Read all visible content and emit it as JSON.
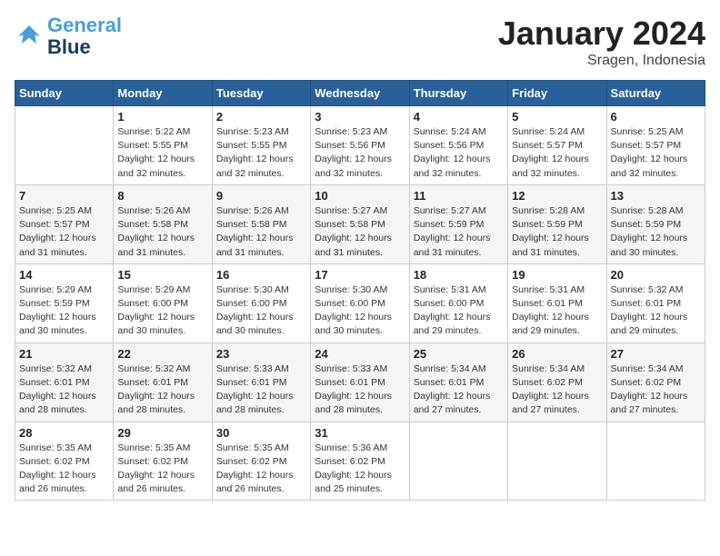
{
  "header": {
    "logo_line1": "General",
    "logo_line2": "Blue",
    "month": "January 2024",
    "location": "Sragen, Indonesia"
  },
  "days_of_week": [
    "Sunday",
    "Monday",
    "Tuesday",
    "Wednesday",
    "Thursday",
    "Friday",
    "Saturday"
  ],
  "weeks": [
    [
      {
        "day": "",
        "info": ""
      },
      {
        "day": "1",
        "info": "Sunrise: 5:22 AM\nSunset: 5:55 PM\nDaylight: 12 hours\nand 32 minutes."
      },
      {
        "day": "2",
        "info": "Sunrise: 5:23 AM\nSunset: 5:55 PM\nDaylight: 12 hours\nand 32 minutes."
      },
      {
        "day": "3",
        "info": "Sunrise: 5:23 AM\nSunset: 5:56 PM\nDaylight: 12 hours\nand 32 minutes."
      },
      {
        "day": "4",
        "info": "Sunrise: 5:24 AM\nSunset: 5:56 PM\nDaylight: 12 hours\nand 32 minutes."
      },
      {
        "day": "5",
        "info": "Sunrise: 5:24 AM\nSunset: 5:57 PM\nDaylight: 12 hours\nand 32 minutes."
      },
      {
        "day": "6",
        "info": "Sunrise: 5:25 AM\nSunset: 5:57 PM\nDaylight: 12 hours\nand 32 minutes."
      }
    ],
    [
      {
        "day": "7",
        "info": "Sunrise: 5:25 AM\nSunset: 5:57 PM\nDaylight: 12 hours\nand 31 minutes."
      },
      {
        "day": "8",
        "info": "Sunrise: 5:26 AM\nSunset: 5:58 PM\nDaylight: 12 hours\nand 31 minutes."
      },
      {
        "day": "9",
        "info": "Sunrise: 5:26 AM\nSunset: 5:58 PM\nDaylight: 12 hours\nand 31 minutes."
      },
      {
        "day": "10",
        "info": "Sunrise: 5:27 AM\nSunset: 5:58 PM\nDaylight: 12 hours\nand 31 minutes."
      },
      {
        "day": "11",
        "info": "Sunrise: 5:27 AM\nSunset: 5:59 PM\nDaylight: 12 hours\nand 31 minutes."
      },
      {
        "day": "12",
        "info": "Sunrise: 5:28 AM\nSunset: 5:59 PM\nDaylight: 12 hours\nand 31 minutes."
      },
      {
        "day": "13",
        "info": "Sunrise: 5:28 AM\nSunset: 5:59 PM\nDaylight: 12 hours\nand 30 minutes."
      }
    ],
    [
      {
        "day": "14",
        "info": "Sunrise: 5:29 AM\nSunset: 5:59 PM\nDaylight: 12 hours\nand 30 minutes."
      },
      {
        "day": "15",
        "info": "Sunrise: 5:29 AM\nSunset: 6:00 PM\nDaylight: 12 hours\nand 30 minutes."
      },
      {
        "day": "16",
        "info": "Sunrise: 5:30 AM\nSunset: 6:00 PM\nDaylight: 12 hours\nand 30 minutes."
      },
      {
        "day": "17",
        "info": "Sunrise: 5:30 AM\nSunset: 6:00 PM\nDaylight: 12 hours\nand 30 minutes."
      },
      {
        "day": "18",
        "info": "Sunrise: 5:31 AM\nSunset: 6:00 PM\nDaylight: 12 hours\nand 29 minutes."
      },
      {
        "day": "19",
        "info": "Sunrise: 5:31 AM\nSunset: 6:01 PM\nDaylight: 12 hours\nand 29 minutes."
      },
      {
        "day": "20",
        "info": "Sunrise: 5:32 AM\nSunset: 6:01 PM\nDaylight: 12 hours\nand 29 minutes."
      }
    ],
    [
      {
        "day": "21",
        "info": "Sunrise: 5:32 AM\nSunset: 6:01 PM\nDaylight: 12 hours\nand 28 minutes."
      },
      {
        "day": "22",
        "info": "Sunrise: 5:32 AM\nSunset: 6:01 PM\nDaylight: 12 hours\nand 28 minutes."
      },
      {
        "day": "23",
        "info": "Sunrise: 5:33 AM\nSunset: 6:01 PM\nDaylight: 12 hours\nand 28 minutes."
      },
      {
        "day": "24",
        "info": "Sunrise: 5:33 AM\nSunset: 6:01 PM\nDaylight: 12 hours\nand 28 minutes."
      },
      {
        "day": "25",
        "info": "Sunrise: 5:34 AM\nSunset: 6:01 PM\nDaylight: 12 hours\nand 27 minutes."
      },
      {
        "day": "26",
        "info": "Sunrise: 5:34 AM\nSunset: 6:02 PM\nDaylight: 12 hours\nand 27 minutes."
      },
      {
        "day": "27",
        "info": "Sunrise: 5:34 AM\nSunset: 6:02 PM\nDaylight: 12 hours\nand 27 minutes."
      }
    ],
    [
      {
        "day": "28",
        "info": "Sunrise: 5:35 AM\nSunset: 6:02 PM\nDaylight: 12 hours\nand 26 minutes."
      },
      {
        "day": "29",
        "info": "Sunrise: 5:35 AM\nSunset: 6:02 PM\nDaylight: 12 hours\nand 26 minutes."
      },
      {
        "day": "30",
        "info": "Sunrise: 5:35 AM\nSunset: 6:02 PM\nDaylight: 12 hours\nand 26 minutes."
      },
      {
        "day": "31",
        "info": "Sunrise: 5:36 AM\nSunset: 6:02 PM\nDaylight: 12 hours\nand 25 minutes."
      },
      {
        "day": "",
        "info": ""
      },
      {
        "day": "",
        "info": ""
      },
      {
        "day": "",
        "info": ""
      }
    ]
  ]
}
